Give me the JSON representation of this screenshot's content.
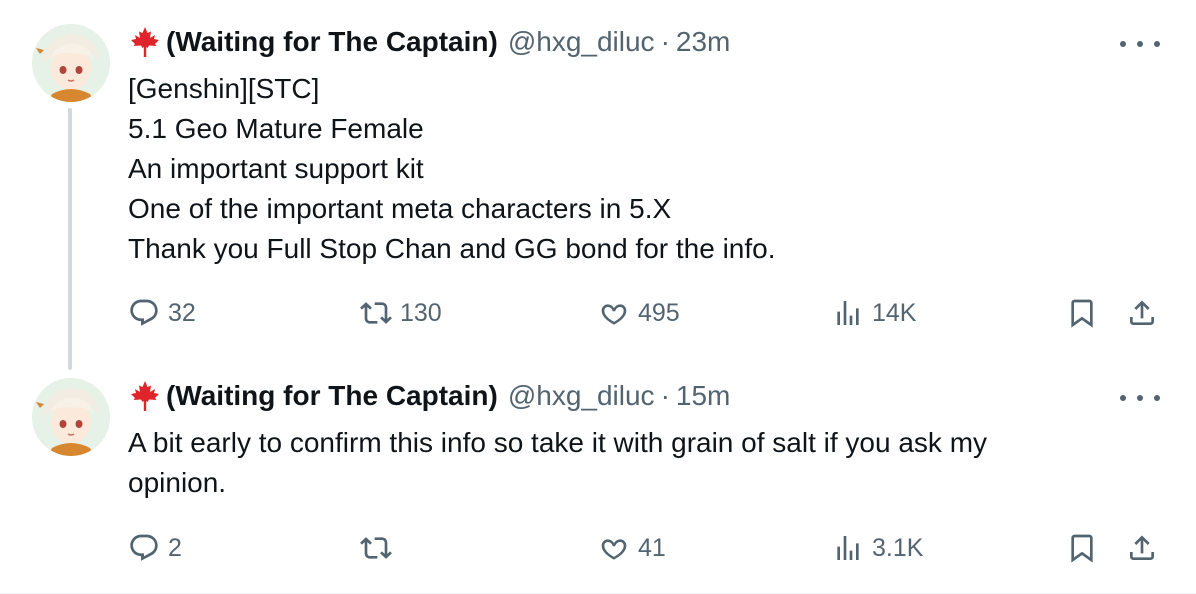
{
  "tweets": [
    {
      "display_name": "(Waiting for The Captain)",
      "handle": "@hxg_diluc",
      "separator": "·",
      "time": "23m",
      "name_emoji_icon": "maple-leaf-icon",
      "text_lines": [
        "[Genshin][STC]",
        "5.1 Geo Mature Female",
        "An important support kit",
        "One of the important meta characters in 5.X",
        "Thank you Full Stop Chan and GG bond for the info."
      ],
      "replies": "32",
      "retweets": "130",
      "likes": "495",
      "views": "14K"
    },
    {
      "display_name": "(Waiting for The Captain)",
      "handle": "@hxg_diluc",
      "separator": "·",
      "time": "15m",
      "name_emoji_icon": "maple-leaf-icon",
      "text_lines": [
        "A bit early to confirm this info so take it with grain of salt if you ask my",
        "opinion."
      ],
      "replies": "2",
      "retweets": "",
      "likes": "41",
      "views": "3.1K"
    }
  ],
  "colors": {
    "text_primary": "#0f1419",
    "text_secondary": "#536471",
    "thread_line": "#cfd9de",
    "maple_red": "#e0242b"
  }
}
